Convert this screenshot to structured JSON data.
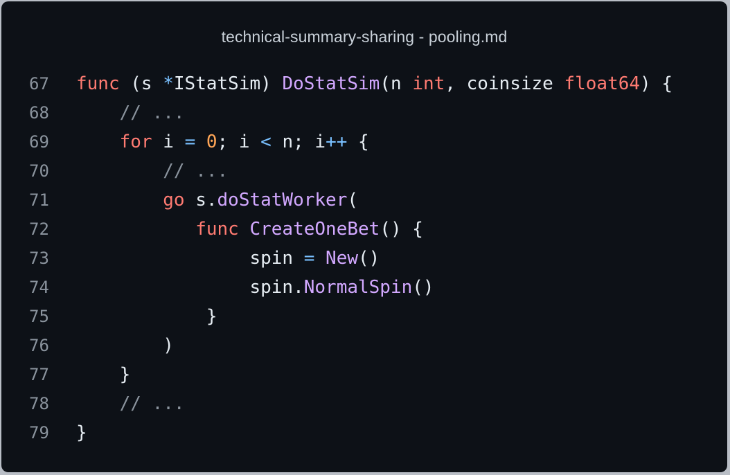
{
  "window": {
    "title": "technical-summary-sharing - pooling.md"
  },
  "code": {
    "lines": [
      {
        "number": "67",
        "tokens": [
          {
            "t": "kw",
            "v": "func"
          },
          {
            "t": "tx",
            "v": " (s "
          },
          {
            "t": "op",
            "v": "*"
          },
          {
            "t": "tx",
            "v": "IStatSim) "
          },
          {
            "t": "fn",
            "v": "DoStatSim"
          },
          {
            "t": "tx",
            "v": "(n "
          },
          {
            "t": "kw",
            "v": "int"
          },
          {
            "t": "tx",
            "v": ", coinsize "
          },
          {
            "t": "kw",
            "v": "float64"
          },
          {
            "t": "tx",
            "v": ") {"
          }
        ]
      },
      {
        "number": "68",
        "tokens": [
          {
            "t": "tx",
            "v": "    "
          },
          {
            "t": "cm",
            "v": "// ..."
          }
        ]
      },
      {
        "number": "69",
        "tokens": [
          {
            "t": "tx",
            "v": "    "
          },
          {
            "t": "kw",
            "v": "for"
          },
          {
            "t": "tx",
            "v": " i "
          },
          {
            "t": "op",
            "v": "="
          },
          {
            "t": "tx",
            "v": " "
          },
          {
            "t": "num",
            "v": "0"
          },
          {
            "t": "tx",
            "v": "; i "
          },
          {
            "t": "op",
            "v": "<"
          },
          {
            "t": "tx",
            "v": " n; i"
          },
          {
            "t": "op",
            "v": "++"
          },
          {
            "t": "tx",
            "v": " {"
          }
        ]
      },
      {
        "number": "70",
        "tokens": [
          {
            "t": "tx",
            "v": "        "
          },
          {
            "t": "cm",
            "v": "// ..."
          }
        ]
      },
      {
        "number": "71",
        "tokens": [
          {
            "t": "tx",
            "v": "        "
          },
          {
            "t": "kw",
            "v": "go"
          },
          {
            "t": "tx",
            "v": " s."
          },
          {
            "t": "fn",
            "v": "doStatWorker"
          },
          {
            "t": "tx",
            "v": "("
          }
        ]
      },
      {
        "number": "72",
        "tokens": [
          {
            "t": "tx",
            "v": "           "
          },
          {
            "t": "kw",
            "v": "func"
          },
          {
            "t": "tx",
            "v": " "
          },
          {
            "t": "fn",
            "v": "CreateOneBet"
          },
          {
            "t": "tx",
            "v": "() {"
          }
        ]
      },
      {
        "number": "73",
        "tokens": [
          {
            "t": "tx",
            "v": "                spin "
          },
          {
            "t": "op",
            "v": "="
          },
          {
            "t": "tx",
            "v": " "
          },
          {
            "t": "fn",
            "v": "New"
          },
          {
            "t": "tx",
            "v": "()"
          }
        ]
      },
      {
        "number": "74",
        "tokens": [
          {
            "t": "tx",
            "v": "                spin."
          },
          {
            "t": "fn",
            "v": "NormalSpin"
          },
          {
            "t": "tx",
            "v": "()"
          }
        ]
      },
      {
        "number": "75",
        "tokens": [
          {
            "t": "tx",
            "v": "            }"
          }
        ]
      },
      {
        "number": "76",
        "tokens": [
          {
            "t": "tx",
            "v": "        )"
          }
        ]
      },
      {
        "number": "77",
        "tokens": [
          {
            "t": "tx",
            "v": "    }"
          }
        ]
      },
      {
        "number": "78",
        "tokens": [
          {
            "t": "tx",
            "v": "    "
          },
          {
            "t": "cm",
            "v": "// ..."
          }
        ]
      },
      {
        "number": "79",
        "tokens": [
          {
            "t": "tx",
            "v": "}"
          }
        ]
      }
    ]
  }
}
